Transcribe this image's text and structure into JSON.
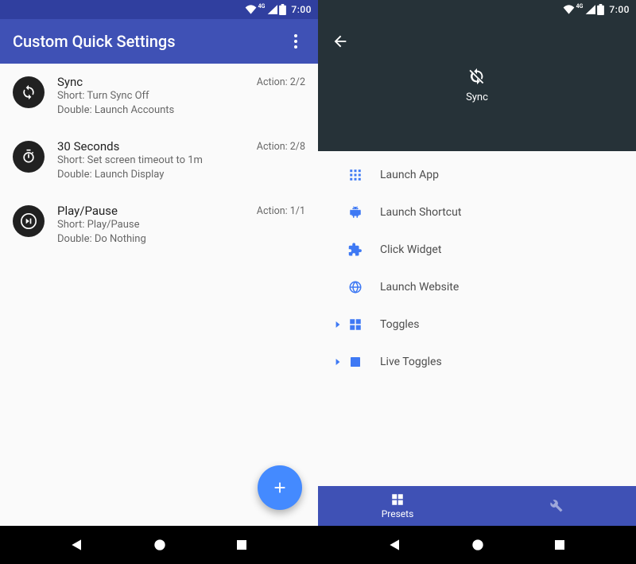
{
  "status": {
    "net": "4G",
    "time": "7:00"
  },
  "left": {
    "title": "Custom Quick Settings",
    "items": [
      {
        "icon": "sync",
        "title": "Sync",
        "short": "Short: Turn Sync Off",
        "double": "Double: Launch Accounts",
        "meta": "Action: 2/2"
      },
      {
        "icon": "timer",
        "title": "30 Seconds",
        "short": "Short: Set screen timeout to 1m",
        "double": "Double: Launch Display",
        "meta": "Action: 2/8"
      },
      {
        "icon": "playpause",
        "title": "Play/Pause",
        "short": "Short: Play/Pause",
        "double": "Double: Do Nothing",
        "meta": "Action: 1/1"
      }
    ]
  },
  "right": {
    "tile_label": "Sync",
    "options": [
      {
        "icon": "apps",
        "label": "Launch App",
        "expandable": false
      },
      {
        "icon": "android",
        "label": "Launch Shortcut",
        "expandable": false
      },
      {
        "icon": "extension",
        "label": "Click Widget",
        "expandable": false
      },
      {
        "icon": "globe",
        "label": "Launch Website",
        "expandable": false
      },
      {
        "icon": "grid",
        "label": "Toggles",
        "expandable": true
      },
      {
        "icon": "film",
        "label": "Live Toggles",
        "expandable": true
      }
    ],
    "bottom": {
      "active": "Presets"
    }
  }
}
